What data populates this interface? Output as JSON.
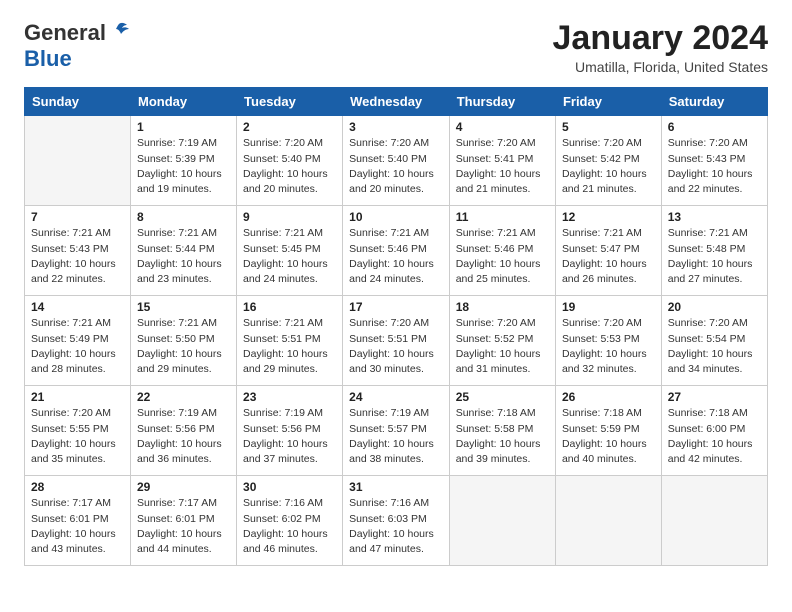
{
  "header": {
    "logo_general": "General",
    "logo_blue": "Blue",
    "month_title": "January 2024",
    "subtitle": "Umatilla, Florida, United States"
  },
  "weekdays": [
    "Sunday",
    "Monday",
    "Tuesday",
    "Wednesday",
    "Thursday",
    "Friday",
    "Saturday"
  ],
  "weeks": [
    [
      {
        "day": "",
        "info": ""
      },
      {
        "day": "1",
        "info": "Sunrise: 7:19 AM\nSunset: 5:39 PM\nDaylight: 10 hours\nand 19 minutes."
      },
      {
        "day": "2",
        "info": "Sunrise: 7:20 AM\nSunset: 5:40 PM\nDaylight: 10 hours\nand 20 minutes."
      },
      {
        "day": "3",
        "info": "Sunrise: 7:20 AM\nSunset: 5:40 PM\nDaylight: 10 hours\nand 20 minutes."
      },
      {
        "day": "4",
        "info": "Sunrise: 7:20 AM\nSunset: 5:41 PM\nDaylight: 10 hours\nand 21 minutes."
      },
      {
        "day": "5",
        "info": "Sunrise: 7:20 AM\nSunset: 5:42 PM\nDaylight: 10 hours\nand 21 minutes."
      },
      {
        "day": "6",
        "info": "Sunrise: 7:20 AM\nSunset: 5:43 PM\nDaylight: 10 hours\nand 22 minutes."
      }
    ],
    [
      {
        "day": "7",
        "info": "Sunrise: 7:21 AM\nSunset: 5:43 PM\nDaylight: 10 hours\nand 22 minutes."
      },
      {
        "day": "8",
        "info": "Sunrise: 7:21 AM\nSunset: 5:44 PM\nDaylight: 10 hours\nand 23 minutes."
      },
      {
        "day": "9",
        "info": "Sunrise: 7:21 AM\nSunset: 5:45 PM\nDaylight: 10 hours\nand 24 minutes."
      },
      {
        "day": "10",
        "info": "Sunrise: 7:21 AM\nSunset: 5:46 PM\nDaylight: 10 hours\nand 24 minutes."
      },
      {
        "day": "11",
        "info": "Sunrise: 7:21 AM\nSunset: 5:46 PM\nDaylight: 10 hours\nand 25 minutes."
      },
      {
        "day": "12",
        "info": "Sunrise: 7:21 AM\nSunset: 5:47 PM\nDaylight: 10 hours\nand 26 minutes."
      },
      {
        "day": "13",
        "info": "Sunrise: 7:21 AM\nSunset: 5:48 PM\nDaylight: 10 hours\nand 27 minutes."
      }
    ],
    [
      {
        "day": "14",
        "info": "Sunrise: 7:21 AM\nSunset: 5:49 PM\nDaylight: 10 hours\nand 28 minutes."
      },
      {
        "day": "15",
        "info": "Sunrise: 7:21 AM\nSunset: 5:50 PM\nDaylight: 10 hours\nand 29 minutes."
      },
      {
        "day": "16",
        "info": "Sunrise: 7:21 AM\nSunset: 5:51 PM\nDaylight: 10 hours\nand 29 minutes."
      },
      {
        "day": "17",
        "info": "Sunrise: 7:20 AM\nSunset: 5:51 PM\nDaylight: 10 hours\nand 30 minutes."
      },
      {
        "day": "18",
        "info": "Sunrise: 7:20 AM\nSunset: 5:52 PM\nDaylight: 10 hours\nand 31 minutes."
      },
      {
        "day": "19",
        "info": "Sunrise: 7:20 AM\nSunset: 5:53 PM\nDaylight: 10 hours\nand 32 minutes."
      },
      {
        "day": "20",
        "info": "Sunrise: 7:20 AM\nSunset: 5:54 PM\nDaylight: 10 hours\nand 34 minutes."
      }
    ],
    [
      {
        "day": "21",
        "info": "Sunrise: 7:20 AM\nSunset: 5:55 PM\nDaylight: 10 hours\nand 35 minutes."
      },
      {
        "day": "22",
        "info": "Sunrise: 7:19 AM\nSunset: 5:56 PM\nDaylight: 10 hours\nand 36 minutes."
      },
      {
        "day": "23",
        "info": "Sunrise: 7:19 AM\nSunset: 5:56 PM\nDaylight: 10 hours\nand 37 minutes."
      },
      {
        "day": "24",
        "info": "Sunrise: 7:19 AM\nSunset: 5:57 PM\nDaylight: 10 hours\nand 38 minutes."
      },
      {
        "day": "25",
        "info": "Sunrise: 7:18 AM\nSunset: 5:58 PM\nDaylight: 10 hours\nand 39 minutes."
      },
      {
        "day": "26",
        "info": "Sunrise: 7:18 AM\nSunset: 5:59 PM\nDaylight: 10 hours\nand 40 minutes."
      },
      {
        "day": "27",
        "info": "Sunrise: 7:18 AM\nSunset: 6:00 PM\nDaylight: 10 hours\nand 42 minutes."
      }
    ],
    [
      {
        "day": "28",
        "info": "Sunrise: 7:17 AM\nSunset: 6:01 PM\nDaylight: 10 hours\nand 43 minutes."
      },
      {
        "day": "29",
        "info": "Sunrise: 7:17 AM\nSunset: 6:01 PM\nDaylight: 10 hours\nand 44 minutes."
      },
      {
        "day": "30",
        "info": "Sunrise: 7:16 AM\nSunset: 6:02 PM\nDaylight: 10 hours\nand 46 minutes."
      },
      {
        "day": "31",
        "info": "Sunrise: 7:16 AM\nSunset: 6:03 PM\nDaylight: 10 hours\nand 47 minutes."
      },
      {
        "day": "",
        "info": ""
      },
      {
        "day": "",
        "info": ""
      },
      {
        "day": "",
        "info": ""
      }
    ]
  ]
}
